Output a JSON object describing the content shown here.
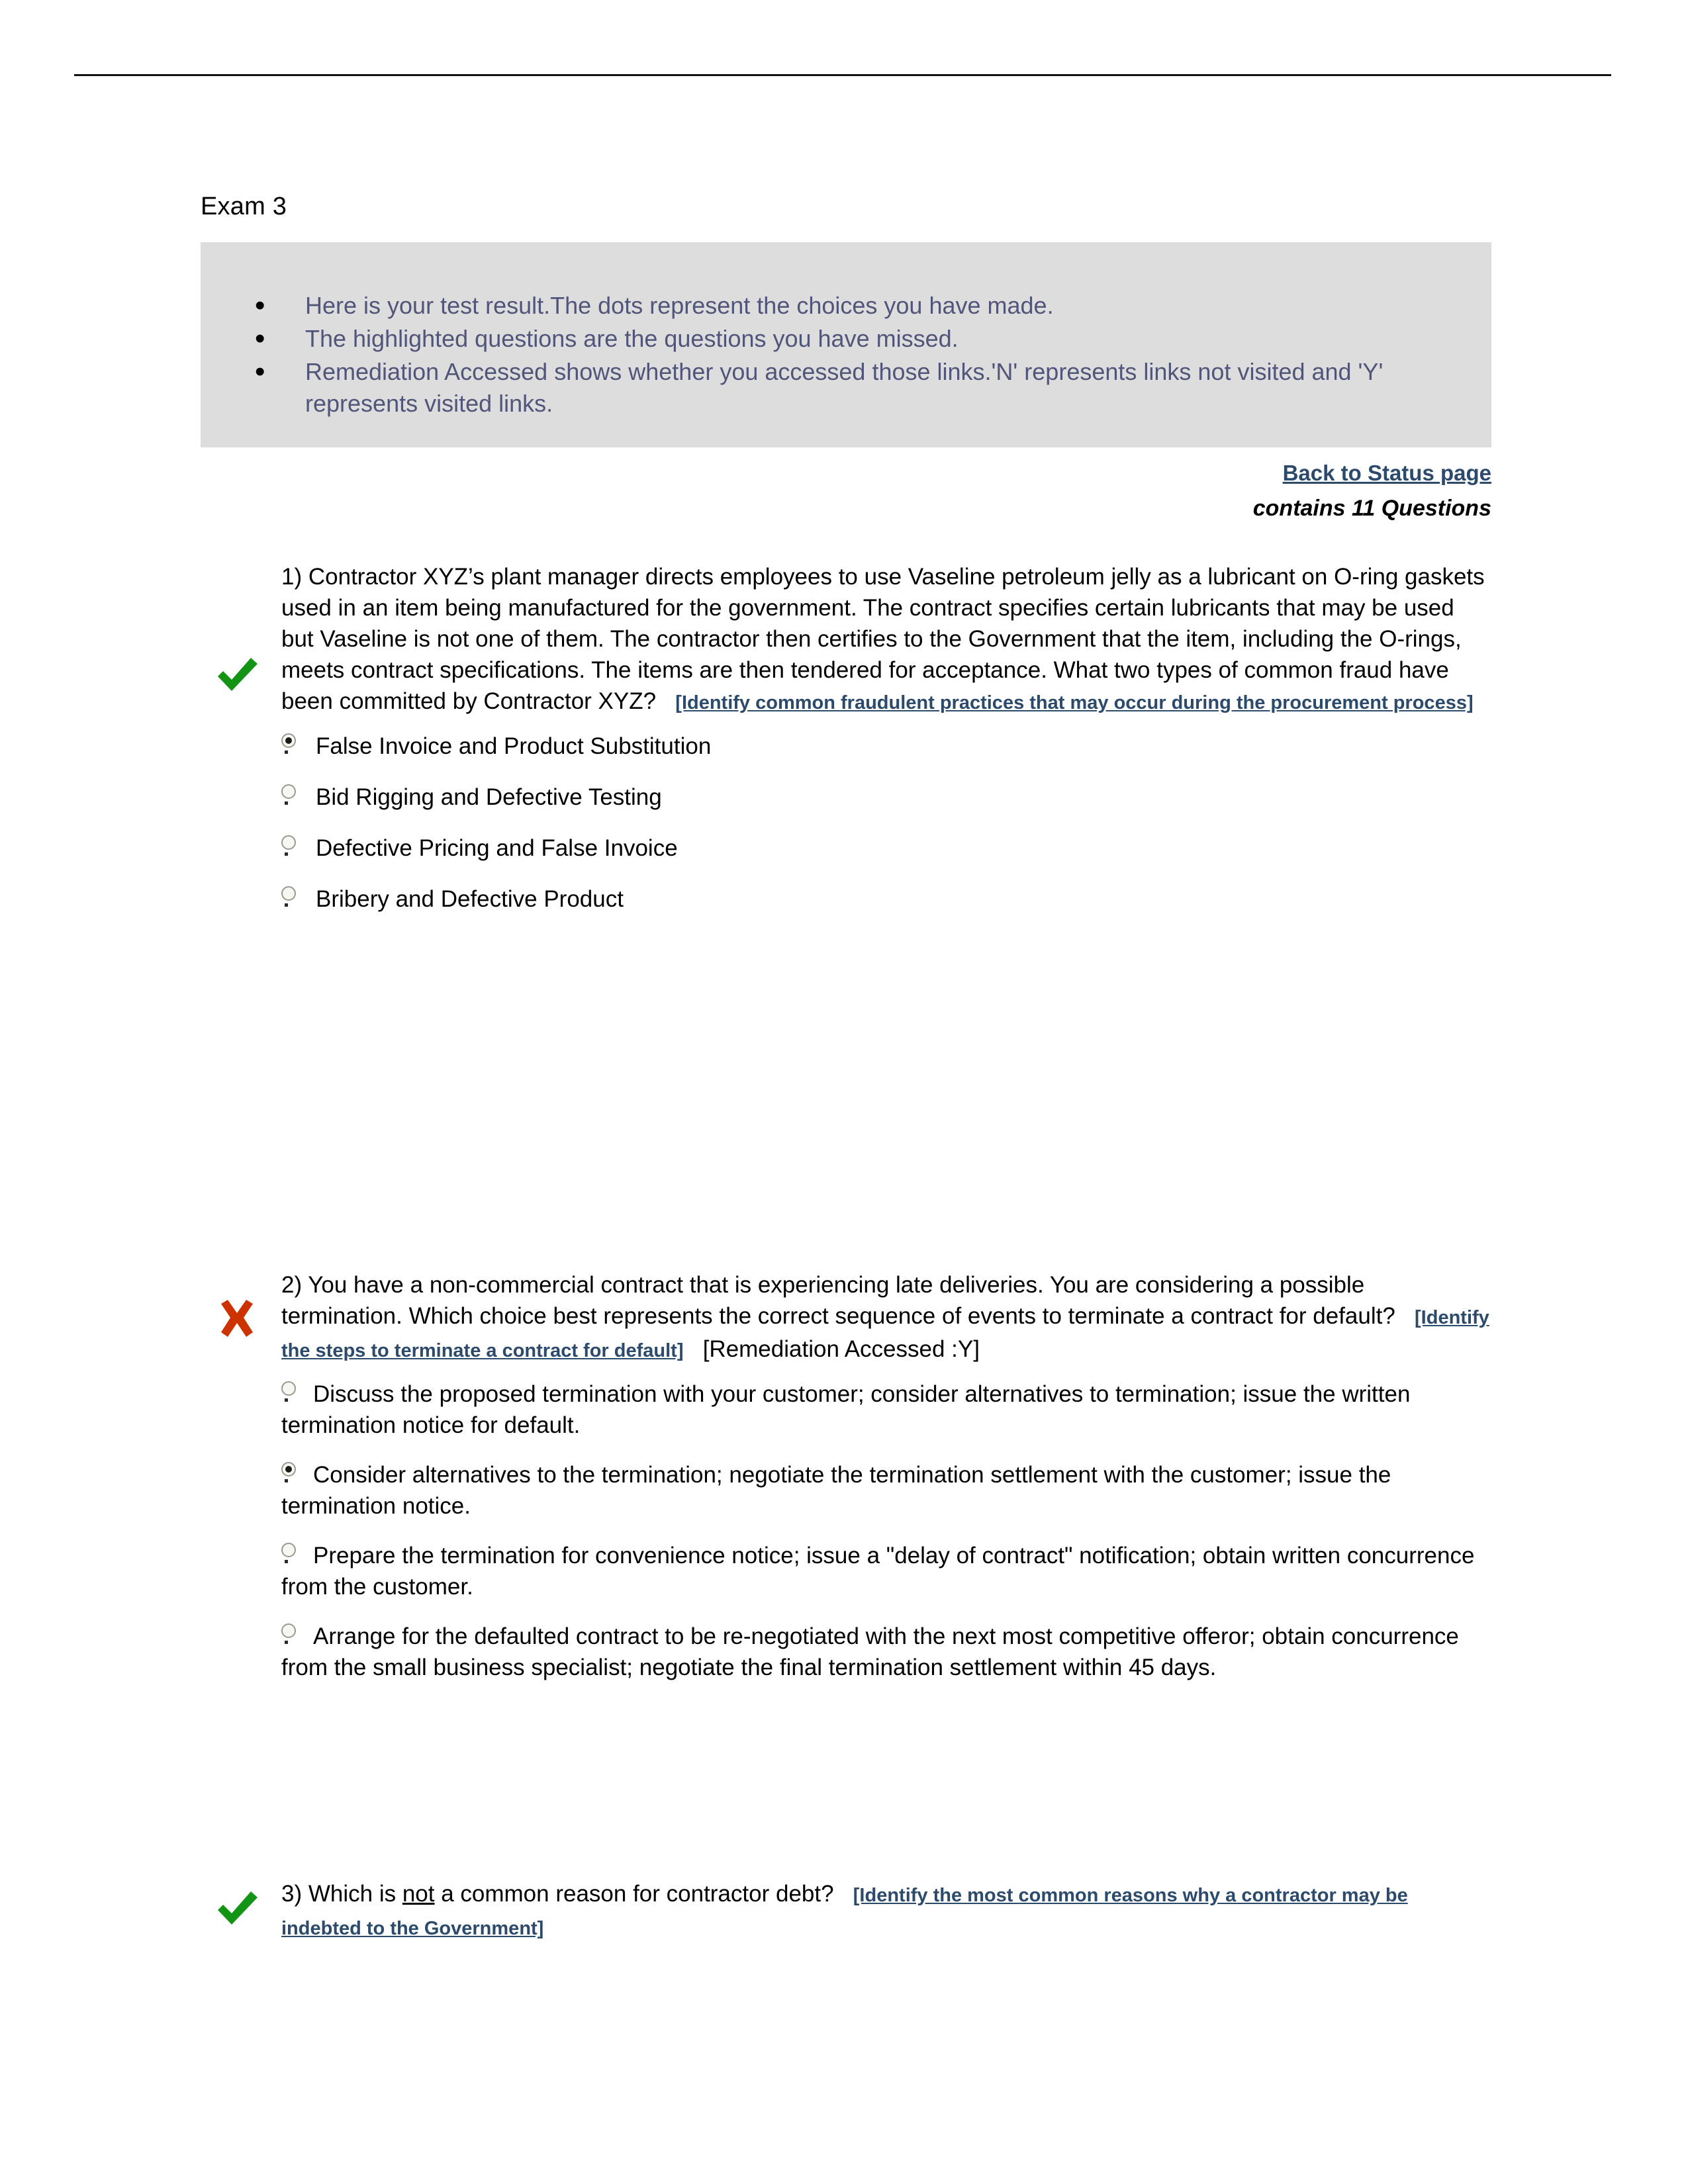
{
  "document": {
    "title": "Exam 3"
  },
  "instructions": {
    "items": [
      "Here is your test result.The dots represent the choices you have made.",
      "The highlighted questions are the questions you have missed.",
      "Remediation Accessed shows whether you accessed those links.'N' represents links not visited and 'Y' represents visited links."
    ],
    "text_color": "#51557a",
    "background": "#dddddd"
  },
  "nav": {
    "back_link": "Back to Status page",
    "contains_line": "contains 11 Questions"
  },
  "colors": {
    "link": "#2c4a6b",
    "correct": "#149414",
    "incorrect": "#cc3300"
  },
  "questions": [
    {
      "number": "1)",
      "result_icon": "check-icon",
      "result": "correct",
      "text": "Contractor XYZ’s plant manager directs employees to use Vaseline petroleum jelly as a lubricant on O-ring gaskets used in an item being manufactured for the government. The contract specifies certain lubricants that may be used but Vaseline is not one of them. The contractor then certifies to the Government that the item, including the O-rings, meets contract specifications. The items are then tendered for acceptance. What two types of common fraud have been committed by Contractor XYZ?",
      "remediation_link": "[Identify common fraudulent practices that may occur during the procurement process]",
      "remediation_accessed": "",
      "options": [
        {
          "label": "False Invoice and Product Substitution",
          "selected": true
        },
        {
          "label": "Bid Rigging and Defective Testing",
          "selected": false
        },
        {
          "label": "Defective Pricing and False Invoice",
          "selected": false
        },
        {
          "label": "Bribery and Defective Product",
          "selected": false
        }
      ]
    },
    {
      "number": "2)",
      "result_icon": "x-icon",
      "result": "incorrect",
      "text": "You have a non-commercial contract that is experiencing late deliveries. You are considering a possible termination. Which choice best represents the correct sequence of events to terminate a contract for default?",
      "remediation_link": "[Identify the steps to terminate a contract for default]",
      "remediation_accessed": "[Remediation Accessed :Y]",
      "options": [
        {
          "label": "Discuss the proposed termination with your customer; consider alternatives to termination; issue the written termination notice for default.",
          "selected": false
        },
        {
          "label": "Consider alternatives to the termination; negotiate the termination settlement with the customer; issue the termination notice.",
          "selected": true
        },
        {
          "label": "Prepare the termination for convenience notice; issue a \"delay of contract\" notification; obtain written concurrence from the customer.",
          "selected": false
        },
        {
          "label": "Arrange for the defaulted contract to be re-negotiated with the next most competitive offeror; obtain concurrence from the small business specialist; negotiate the final termination settlement within 45 days.",
          "selected": false
        }
      ]
    },
    {
      "number": "3)",
      "result_icon": "check-icon",
      "result": "correct",
      "text_prefix": "Which is ",
      "text_underlined": "not",
      "text_suffix": " a common reason for contractor debt?",
      "remediation_link": "[Identify the most common reasons why a contractor may be indebted to the Government]",
      "remediation_accessed": "",
      "options": []
    }
  ]
}
